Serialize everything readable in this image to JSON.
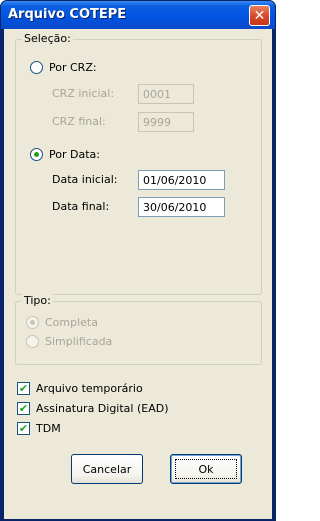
{
  "window": {
    "title": "Arquivo COTEPE",
    "close_label": "✕"
  },
  "selecao": {
    "legend": "Seleção:",
    "por_crz": {
      "label": "Por CRZ:",
      "checked": false
    },
    "crz_inicial": {
      "label": "CRZ inicial:",
      "value": "0001"
    },
    "crz_final": {
      "label": "CRZ final:",
      "value": "9999"
    },
    "por_data": {
      "label": "Por Data:",
      "checked": true
    },
    "data_inicial": {
      "label": "Data inicial:",
      "value": "01/06/2010"
    },
    "data_final": {
      "label": "Data final:",
      "value": "30/06/2010"
    }
  },
  "tipo": {
    "legend": "Tipo:",
    "completa": {
      "label": "Completa",
      "checked": true
    },
    "simplificada": {
      "label": "Simplificada",
      "checked": false
    }
  },
  "options": {
    "arquivo_temporario": {
      "label": "Arquivo temporário",
      "checked": true
    },
    "assinatura_digital": {
      "label": "Assinatura Digital (EAD)",
      "checked": true
    },
    "tdm": {
      "label": "TDM",
      "checked": true
    }
  },
  "buttons": {
    "cancel": "Cancelar",
    "ok": "Ok"
  },
  "icons": {
    "check": "✔"
  }
}
